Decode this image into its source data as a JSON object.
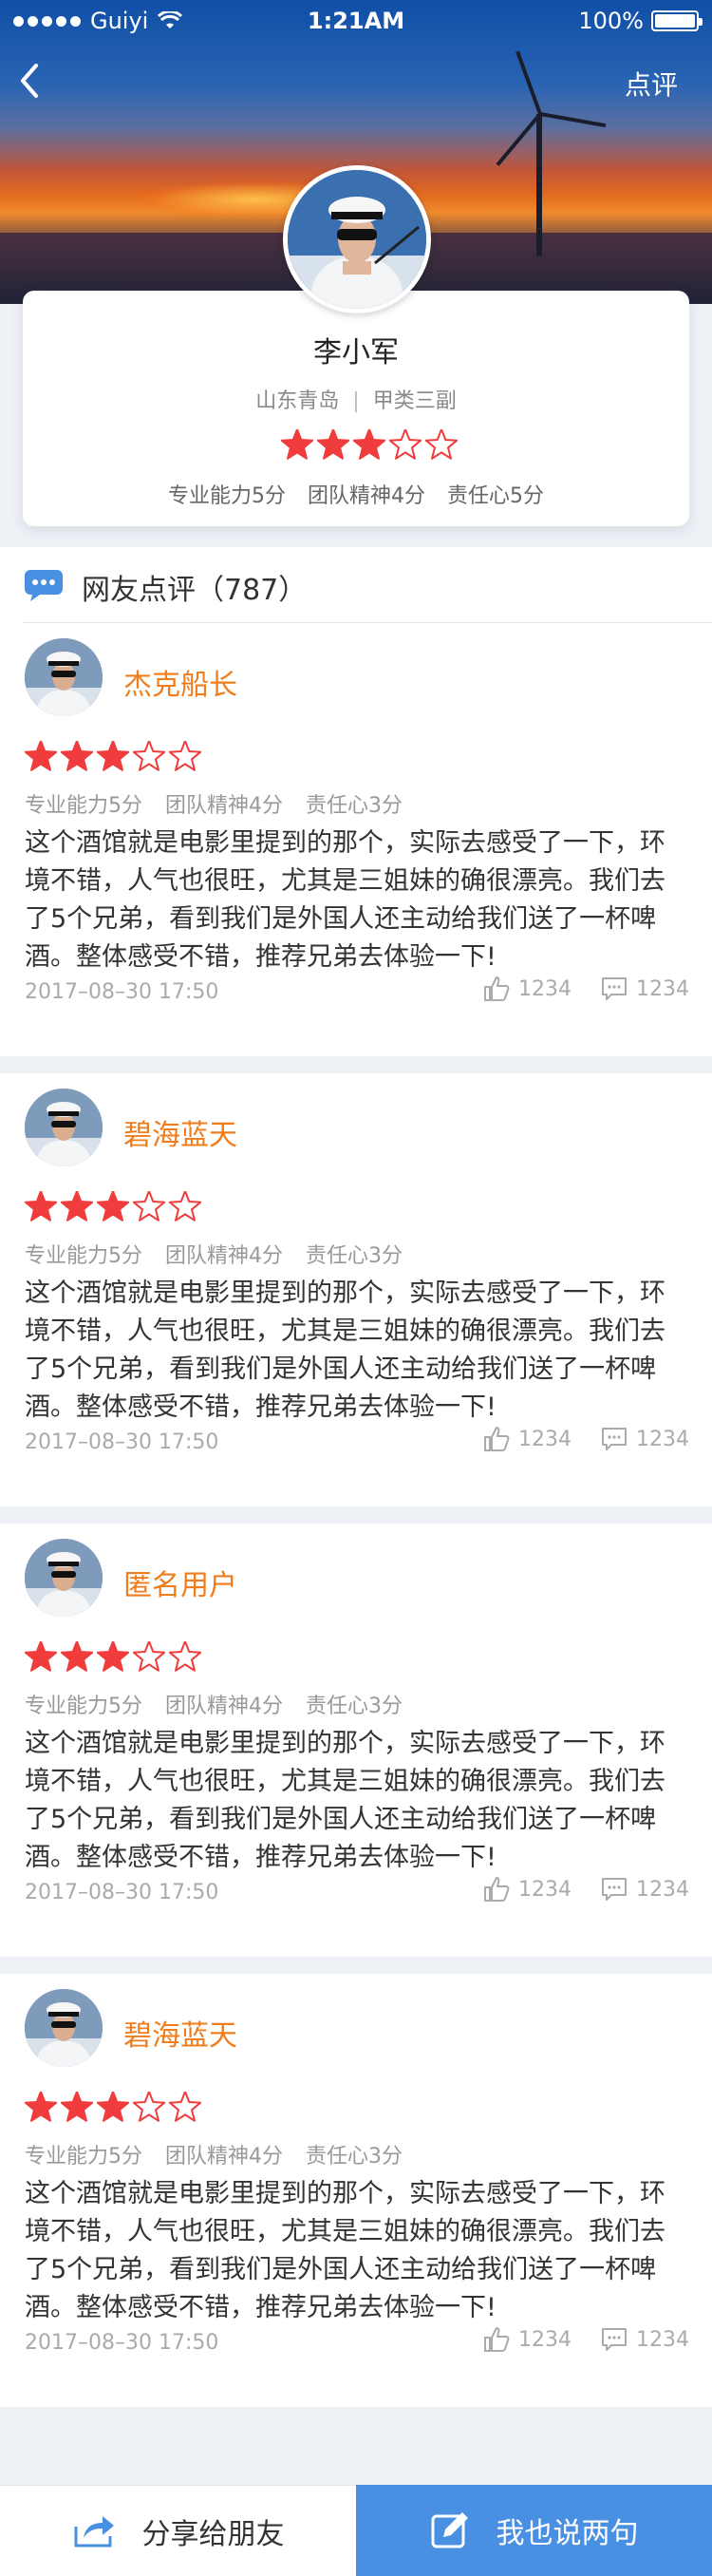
{
  "status_bar": {
    "carrier": "Guiyi",
    "time": "1:21AM",
    "battery": "100%",
    "battery_level": 1.0
  },
  "nav": {
    "right_action": "点评",
    "back_icon": "chevron-left-icon"
  },
  "profile": {
    "name": "李小军",
    "location": "山东青岛",
    "rank": "甲类三副",
    "rating": 3,
    "rating_max": 5,
    "scores": [
      "专业能力5分",
      "团队精神4分",
      "责任心5分"
    ]
  },
  "reviews_section": {
    "title": "网友点评（787）",
    "icon": "chat-bubble-icon"
  },
  "comments": [
    {
      "name": "杰克船长",
      "rating": 3,
      "scores": [
        "专业能力5分",
        "团队精神4分",
        "责任心3分"
      ],
      "text": "这个酒馆就是电影里提到的那个，实际去感受了一下，环境不错，人气也很旺，尤其是三姐妹的确很漂亮。我们去了5个兄弟，看到我们是外国人还主动给我们送了一杯啤酒。整体感受不错，推荐兄弟去体验一下!",
      "date": "2017–08–30   17:50",
      "likes": "1234",
      "comments": "1234"
    },
    {
      "name": "碧海蓝天",
      "rating": 3,
      "scores": [
        "专业能力5分",
        "团队精神4分",
        "责任心3分"
      ],
      "text": "这个酒馆就是电影里提到的那个，实际去感受了一下，环境不错，人气也很旺，尤其是三姐妹的确很漂亮。我们去了5个兄弟，看到我们是外国人还主动给我们送了一杯啤酒。整体感受不错，推荐兄弟去体验一下!",
      "date": "2017–08–30   17:50",
      "likes": "1234",
      "comments": "1234"
    },
    {
      "name": "匿名用户",
      "rating": 3,
      "scores": [
        "专业能力5分",
        "团队精神4分",
        "责任心3分"
      ],
      "text": "这个酒馆就是电影里提到的那个，实际去感受了一下，环境不错，人气也很旺，尤其是三姐妹的确很漂亮。我们去了5个兄弟，看到我们是外国人还主动给我们送了一杯啤酒。整体感受不错，推荐兄弟去体验一下!",
      "date": "2017–08–30   17:50",
      "likes": "1234",
      "comments": "1234"
    },
    {
      "name": "碧海蓝天",
      "rating": 3,
      "scores": [
        "专业能力5分",
        "团队精神4分",
        "责任心3分"
      ],
      "text": "这个酒馆就是电影里提到的那个，实际去感受了一下，环境不错，人气也很旺，尤其是三姐妹的确很漂亮。我们去了5个兄弟，看到我们是外国人还主动给我们送了一杯啤酒。整体感受不错，推荐兄弟去体验一下!",
      "date": "2017–08–30   17:50",
      "likes": "1234",
      "comments": "1234"
    }
  ],
  "bottom_bar": {
    "share_label": "分享给朋友",
    "write_label": "我也说两句",
    "share_icon": "share-icon",
    "write_icon": "edit-icon"
  },
  "colors": {
    "accent": "#4a90e2",
    "star": "#f03c3c",
    "name_orange": "#f07c1c"
  }
}
